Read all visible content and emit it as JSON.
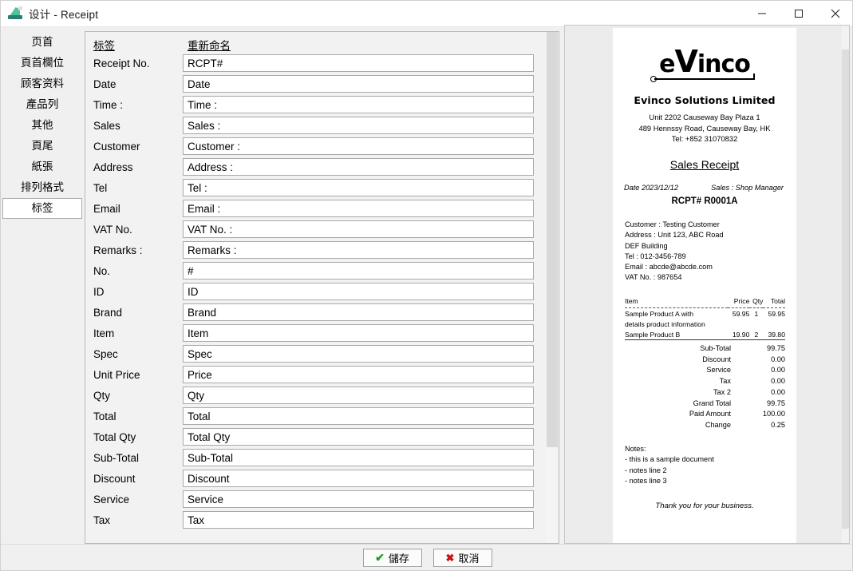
{
  "window": {
    "title": "设计 - Receipt",
    "icon": "app-icon",
    "minimize_label": "—",
    "maximize_label": "□",
    "close_label": "✕"
  },
  "sidebar": {
    "items": [
      {
        "label": "页首",
        "selected": false
      },
      {
        "label": "頁首欄位",
        "selected": false
      },
      {
        "label": "顾客资料",
        "selected": false
      },
      {
        "label": "產品列",
        "selected": false
      },
      {
        "label": "其他",
        "selected": false
      },
      {
        "label": "頁尾",
        "selected": false
      },
      {
        "label": "紙張",
        "selected": false
      },
      {
        "label": "排列格式",
        "selected": false
      },
      {
        "label": "标签",
        "selected": true
      }
    ]
  },
  "form": {
    "header": {
      "label_col": "标签",
      "rename_col": "重新命名"
    },
    "rows": [
      {
        "label": "Receipt No.",
        "value": "RCPT#"
      },
      {
        "label": "Date",
        "value": "Date"
      },
      {
        "label": "Time :",
        "value": "Time :"
      },
      {
        "label": "Sales",
        "value": "Sales :"
      },
      {
        "label": "Customer",
        "value": "Customer :"
      },
      {
        "label": "Address",
        "value": "Address :"
      },
      {
        "label": "Tel",
        "value": "Tel :"
      },
      {
        "label": "Email",
        "value": "Email :"
      },
      {
        "label": "VAT No.",
        "value": "VAT No. :"
      },
      {
        "label": "Remarks :",
        "value": "Remarks :"
      },
      {
        "label": "No.",
        "value": "#"
      },
      {
        "label": "ID",
        "value": "ID"
      },
      {
        "label": "Brand",
        "value": "Brand"
      },
      {
        "label": "Item",
        "value": "Item"
      },
      {
        "label": "Spec",
        "value": "Spec"
      },
      {
        "label": "Unit Price",
        "value": "Price"
      },
      {
        "label": "Qty",
        "value": "Qty"
      },
      {
        "label": "Total",
        "value": "Total"
      },
      {
        "label": "Total Qty",
        "value": "Total Qty"
      },
      {
        "label": "Sub-Total",
        "value": "Sub-Total"
      },
      {
        "label": "Discount",
        "value": "Discount"
      },
      {
        "label": "Service",
        "value": "Service"
      },
      {
        "label": "Tax",
        "value": "Tax"
      }
    ]
  },
  "preview": {
    "logo": {
      "part1": "e",
      "part2": "V",
      "part3": "inco"
    },
    "company": "Evinco Solutions Limited",
    "address_line1": "Unit 2202 Causeway Bay Plaza 1",
    "address_line2": "489 Hennssy Road, Causeway Bay, HK",
    "address_line3": "Tel: +852 31070832",
    "doc_title": "Sales Receipt",
    "date": "Date 2023/12/12",
    "sales": "Sales : Shop Manager",
    "receipt_no": "RCPT# R0001A",
    "customer": "Customer : Testing Customer",
    "address": "Address : Unit 123, ABC Road",
    "address2": "DEF Building",
    "tel": "Tel : 012-3456-789",
    "email": "Email : abcde@abcde.com",
    "vat": "VAT No. : 987654",
    "table": {
      "headers": [
        "Item",
        "Price",
        "Qty",
        "Total"
      ],
      "rows": [
        {
          "item": "Sample Product A with",
          "item2": "details product information",
          "price": "59.95",
          "qty": "1",
          "total": "59.95"
        },
        {
          "item": "Sample Product B",
          "item2": "",
          "price": "19.90",
          "qty": "2",
          "total": "39.80"
        }
      ]
    },
    "totals": [
      {
        "key": "Sub-Total",
        "value": "99.75"
      },
      {
        "key": "Discount",
        "value": "0.00"
      },
      {
        "key": "Service",
        "value": "0.00"
      },
      {
        "key": "Tax",
        "value": "0.00"
      },
      {
        "key": "Tax 2",
        "value": "0.00"
      },
      {
        "key": "Grand Total",
        "value": "99.75"
      },
      {
        "key": "Paid Amount",
        "value": "100.00"
      },
      {
        "key": "Change",
        "value": "0.25"
      }
    ],
    "notes_title": "Notes:",
    "notes": [
      "- this is a sample document",
      "- notes line 2",
      "- notes line 3"
    ],
    "thanks": "Thank you for your business."
  },
  "footer": {
    "save_label": "儲存",
    "cancel_label": "取消",
    "save_icon": "✔",
    "cancel_icon": "✖"
  }
}
